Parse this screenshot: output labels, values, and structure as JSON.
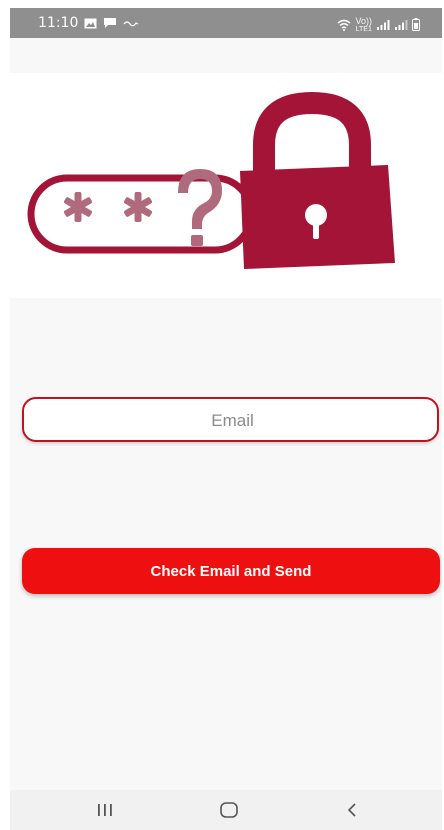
{
  "status_bar": {
    "time": "11:10",
    "carrier_label": "Vo))",
    "lte_label": "LTE1",
    "icons": [
      "gallery-icon",
      "message-icon",
      "notification-text-icon",
      "wifi-icon",
      "signal-icon",
      "signal-icon",
      "battery-icon"
    ]
  },
  "hero": {
    "password_mask": "* * ?",
    "icon": "padlock-icon",
    "accent_color": "#a31437"
  },
  "email_field": {
    "value": "",
    "placeholder": "Email",
    "border_color": "#c0131b"
  },
  "send_button": {
    "label": "Check Email and Send",
    "color": "#ee1010"
  },
  "nav_bar": {
    "buttons": [
      "recent-apps-icon",
      "home-icon",
      "back-icon"
    ]
  }
}
